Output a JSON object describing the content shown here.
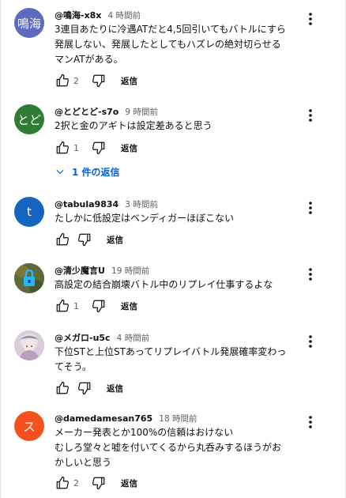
{
  "comments": [
    {
      "avatar_text": "鳴海",
      "avatar_color": "#5c6bc0",
      "author": "@鳴海-x8x",
      "time": "4 時間前",
      "text": "3連目あたりに冷遇ATだと4,5回引いてもバトルにすら\n発展しない、発展したとしてもハズレの絶対切らせる\nマンATがある。",
      "likes": "2",
      "reply_label": "返信"
    },
    {
      "avatar_text": "とど",
      "avatar_color": "#2e7d32",
      "author": "@とどとど-s7o",
      "time": "9 時間前",
      "text": "2択と金のアギトは設定差あると思う",
      "likes": "1",
      "reply_label": "返信",
      "replies_label": "1 件の返信"
    },
    {
      "avatar_text": "t",
      "avatar_color": "#1565c0",
      "author": "@tabula9834",
      "time": "3 時間前",
      "text": "たしかに低設定はベンディガーほぼこない",
      "likes": "",
      "reply_label": "返信"
    },
    {
      "avatar_text": "",
      "avatar_color": "#6b6b3a",
      "author": "@清少魔言U",
      "time": "19 時間前",
      "text": "高設定の結合崩壊バトル中のリプレイ仕事するよな",
      "likes": "1",
      "reply_label": "返信"
    },
    {
      "avatar_text": "",
      "avatar_color": "#c9b8c8",
      "author": "@メガロ-u5c",
      "time": "4 時間前",
      "text": "下位STと上位STあってリプレイバトル発展確率変わっ\nてそう。",
      "likes": "",
      "reply_label": "返信"
    },
    {
      "avatar_text": "ス",
      "avatar_color": "#f4511e",
      "author": "@damedamesan765",
      "time": "18 時間前",
      "text": "メーカー発表とか100%の信頼はおけない\nむしろ堂々と嘘を付いてくるから丸呑みするほうがお\nかしいと思う",
      "likes": "2",
      "reply_label": "返信"
    }
  ]
}
